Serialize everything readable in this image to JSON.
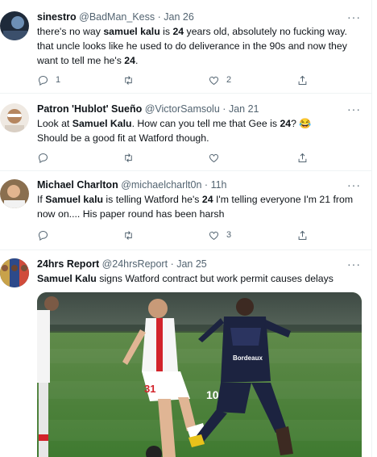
{
  "tweets": [
    {
      "name": "sinestro",
      "handle": "@BadMan_Kess",
      "time": "Jan 26",
      "text": [
        {
          "t": "there's no way "
        },
        {
          "t": "samuel kalu",
          "b": true
        },
        {
          "t": " is "
        },
        {
          "t": "24",
          "b": true
        },
        {
          "t": " years old, absolutely no fucking way. that uncle looks like he used to do deliverance in the 90s and now they want to tell me he's "
        },
        {
          "t": "24",
          "b": true
        },
        {
          "t": "."
        }
      ],
      "replies": "1",
      "retweets": "",
      "likes": "2"
    },
    {
      "name": "Patron 'Hublot' Sueño",
      "handle": "@VictorSamsolu",
      "time": "Jan 21",
      "text": [
        {
          "t": "Look at "
        },
        {
          "t": "Samuel Kalu",
          "b": true
        },
        {
          "t": ". How can you tell me that Gee is "
        },
        {
          "t": "24",
          "b": true
        },
        {
          "t": "? 😂\nShould be a good fit at Watford though."
        }
      ],
      "replies": "",
      "retweets": "",
      "likes": ""
    },
    {
      "name": "Michael Charlton",
      "handle": "@michaelcharlt0n",
      "time": "11h",
      "text": [
        {
          "t": "If "
        },
        {
          "t": "Samuel kalu",
          "b": true
        },
        {
          "t": " is telling Watford he's "
        },
        {
          "t": "24",
          "b": true
        },
        {
          "t": " I'm telling everyone I'm 21 from now on.... His paper round has been harsh"
        }
      ],
      "replies": "",
      "retweets": "",
      "likes": "3"
    },
    {
      "name": "24hrs Report",
      "handle": "@24hrsReport",
      "time": "Jan 25",
      "text": [
        {
          "t": "Samuel Kalu",
          "b": true
        },
        {
          "t": " signs Watford contract but work permit causes delays"
        }
      ]
    }
  ],
  "ui": {
    "separator": "·",
    "more_glyph": "···"
  },
  "media": {
    "shirt_number_left": "31",
    "shirt_number_right": "10",
    "sponsor_text": "Bordeaux"
  },
  "colors": {
    "text": "#0f1419",
    "secondary": "#536471",
    "divider": "#eff3f4",
    "pitch": "#4f8a3a",
    "psg_red": "#d2232a",
    "bordeaux_navy": "#1c2340"
  },
  "icons": [
    "reply-icon",
    "retweet-icon",
    "like-icon",
    "share-icon",
    "more-icon"
  ]
}
